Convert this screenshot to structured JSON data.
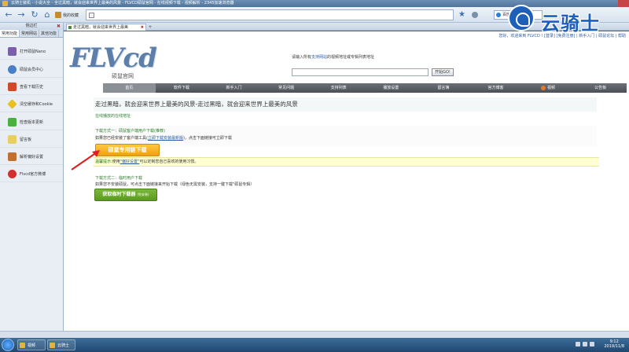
{
  "window": {
    "title": "云骑士装机 - 小说大全 - 全过黑暗，就会迎来世界上最美的风景 - FLVCD硕鼠官网 - 在线视频下载 - 视频解析 - 2345加速浏览器"
  },
  "toolbar": {
    "address_label": "我的收藏",
    "search_placeholder": "百度搜索",
    "search_go": "›"
  },
  "brand": {
    "watermark": "云骑士"
  },
  "sidebar": {
    "title": "侧边栏",
    "tabs": [
      "常用功能",
      "常用网站",
      "其他功能"
    ],
    "items": [
      {
        "label": "打开硕鼠Nano",
        "color": "#7a5ea8"
      },
      {
        "label": "硕鼠会员中心",
        "color": "#4a7fc8"
      },
      {
        "label": "查看下载历史",
        "color": "#d04a2a"
      },
      {
        "label": "清空缓存和Cookie",
        "color": "#e8c020"
      },
      {
        "label": "检查版本更新",
        "color": "#4ab040"
      },
      {
        "label": "留言板",
        "color": "#e8d060"
      },
      {
        "label": "解析偏好设置",
        "color": "#c07030"
      },
      {
        "label": "Flvcd官方微博",
        "color": "#d03030"
      }
    ]
  },
  "tabs": {
    "active": "走过黑暗，就会迎来世界上最美",
    "new_tab": "+"
  },
  "page": {
    "toplinks": "您好，欢迎来到 FLVCD ! [登录] [免费注册] | 新手入门 | 硕鼠论坛 | 帮助",
    "logo_text": "FLVcd",
    "logo_sub": "硕鼠官网",
    "hint_prefix": "请输入所有",
    "hint_link": "支持网站",
    "hint_suffix": "的视频地址或专辑列表地址",
    "start_button": "开始GO!",
    "menu": [
      "首页",
      "软件下载",
      "新手入门",
      "常见问题",
      "支持列表",
      "播放设置",
      "留言簿",
      "官方博客",
      "视频",
      "公告板"
    ],
    "headline": "走过黑暗，就会迎来世界上最美的风景-走过黑暗，就会迎来世界上最美的风景",
    "online_link": "在线播放的在线地址",
    "method1_title": "下载方式一：硕鼠客户端用户下载(推荐)",
    "method1_text_prefix": "如果您已经安装了客户端工具(",
    "method1_link": "立即下载安装最新版",
    "method1_text_suffix": ")，点击下面链接可立即下载",
    "download_button_1": "硕鼠专用链下载",
    "warn_tag": "温馨提示",
    "warn_prefix": ":使用",
    "warn_link": "\"偏好设置\"",
    "warn_suffix": "可以定制您自己喜欢的使用习惯。",
    "method2_title": "下载方式二：临时用户下载",
    "method2_text": "如果您不安装硕鼠，可点击下面链接来开始下载（绿色无需安装，支持一键下载\"硕鼠专辑）",
    "download_button_2": "获取临时下载器",
    "download_button_2_sub": "(免安装)"
  },
  "taskbar": {
    "items": [
      "视频",
      "云骑士"
    ],
    "time": "9:12",
    "date": "2019/11/8"
  }
}
